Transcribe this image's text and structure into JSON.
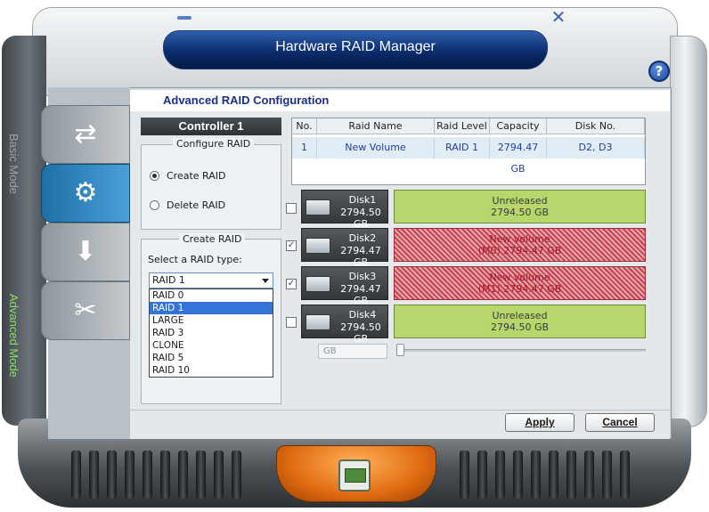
{
  "window": {
    "title": "Hardware RAID Manager"
  },
  "side_modes": {
    "basic": "Basic Mode",
    "advanced": "Advanced Mode"
  },
  "header": {
    "title": "Advanced RAID Configuration"
  },
  "controller": {
    "label": "Controller 1"
  },
  "configure": {
    "group_title": "Configure RAID",
    "options": [
      "Create RAID",
      "Delete RAID"
    ],
    "selected": "Create RAID"
  },
  "create": {
    "group_title": "Create RAID",
    "prompt": "Select a RAID type:",
    "selected": "RAID 1",
    "options": [
      "RAID 0",
      "RAID 1",
      "LARGE",
      "RAID 3",
      "CLONE",
      "RAID 5",
      "RAID 10"
    ]
  },
  "table": {
    "headers": [
      "No.",
      "Raid Name",
      "Raid Level",
      "Capacity",
      "Disk No."
    ],
    "rows": [
      [
        "1",
        "New Volume",
        "RAID 1",
        "2794.47 GB",
        "D2, D3"
      ]
    ]
  },
  "disks": [
    {
      "name": "Disk1",
      "size": "2794.50 GB",
      "checked": false,
      "status": "Unreleased",
      "status_size": "2794.50 GB"
    },
    {
      "name": "Disk2",
      "size": "2794.47 GB",
      "checked": true,
      "status": "New volume",
      "status_size": "(M0) 2794.47 GB"
    },
    {
      "name": "Disk3",
      "size": "2794.47 GB",
      "checked": true,
      "status": "New volume",
      "status_size": "(M1) 2794.47 GB"
    },
    {
      "name": "Disk4",
      "size": "2794.50 GB",
      "checked": false,
      "status": "Unreleased",
      "status_size": "2794.50 GB"
    }
  ],
  "capacity": {
    "unit": "GB",
    "slider_level": 0
  },
  "buttons": {
    "apply": "Apply",
    "cancel": "Cancel"
  },
  "icons": [
    "minimize-icon",
    "close-icon",
    "help-icon",
    "network-tab-icon",
    "raid-tab-icon",
    "download-tab-icon",
    "tools-tab-icon",
    "disk-icon",
    "dropdown-arrow-icon"
  ],
  "colors": {
    "accent": "#1a2f8a",
    "unreleased": "#b7d66b",
    "volume": "#c8424f",
    "selection": "#3275d6"
  }
}
